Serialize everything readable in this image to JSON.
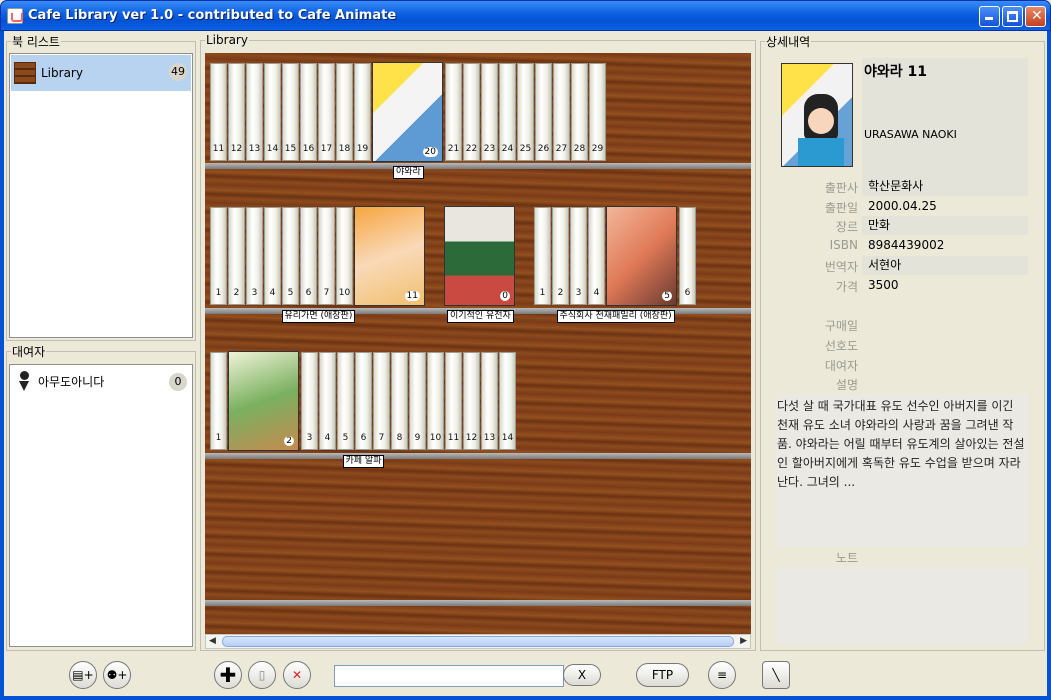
{
  "window": {
    "title": "Cafe Library ver 1.0 - contributed to Cafe Animate"
  },
  "booklist": {
    "legend": "북 리스트",
    "items": [
      {
        "label": "Library",
        "count": "49"
      }
    ]
  },
  "lender": {
    "legend": "대여자",
    "items": [
      {
        "label": "아무도아니다",
        "count": "0"
      }
    ]
  },
  "library": {
    "legend": "Library",
    "shelves": [
      {
        "series": [
          {
            "title": "야와라",
            "spines": [
              "11",
              "12",
              "13",
              "14",
              "15",
              "16",
              "17",
              "18",
              "19"
            ],
            "cover": "20",
            "after": [
              "21",
              "22",
              "23",
              "24",
              "25",
              "26",
              "27",
              "28",
              "29"
            ]
          }
        ]
      },
      {
        "series": [
          {
            "title": "유리가면 (애장판)",
            "spines": [
              "1",
              "2",
              "3",
              "4",
              "5",
              "6",
              "7",
              "10"
            ],
            "cover": "11",
            "after": []
          },
          {
            "title": "이기적인 유전자",
            "spines": [],
            "cover": "0",
            "after": []
          },
          {
            "title": "주식회사 천재패밀리 (애장판)",
            "spines": [
              "1",
              "2",
              "3",
              "4"
            ],
            "cover": "5",
            "after": [
              "6"
            ]
          }
        ]
      },
      {
        "series": [
          {
            "title": "카페 알파",
            "spines": [
              "1"
            ],
            "cover": "2",
            "after": [
              "3",
              "4",
              "5",
              "6",
              "7",
              "8",
              "9",
              "10",
              "11",
              "12",
              "13",
              "14"
            ]
          }
        ]
      }
    ]
  },
  "detail": {
    "legend": "상세내역",
    "book_title": "야와라 11",
    "author": "URASAWA NAOKI",
    "fields": [
      {
        "label": "출판사",
        "value": "학산문화사"
      },
      {
        "label": "출판일",
        "value": "2000.04.25"
      },
      {
        "label": "장르",
        "value": "만화"
      },
      {
        "label": "ISBN",
        "value": "8984439002"
      },
      {
        "label": "번역자",
        "value": "서현아"
      },
      {
        "label": "가격",
        "value": "3500"
      },
      {
        "label": "구매일",
        "value": ""
      },
      {
        "label": "선호도",
        "value": ""
      },
      {
        "label": "대여자",
        "value": ""
      }
    ],
    "desc_label": "설명",
    "description": "다섯 살 때 국가대표 유도 선수인 아버지를 이긴 천재 유도 소녀 야와라의 사랑과 꿈을 그려낸 작품. 야와라는 어릴 때부터 유도계의 살아있는 전설인 할아버지에게 혹독한 유도 수업을 받으며 자라난다. 그녀의 ...",
    "note_label": "노트"
  },
  "toolbar": {
    "clear_label": "X",
    "ftp_label": "FTP",
    "search_value": ""
  }
}
